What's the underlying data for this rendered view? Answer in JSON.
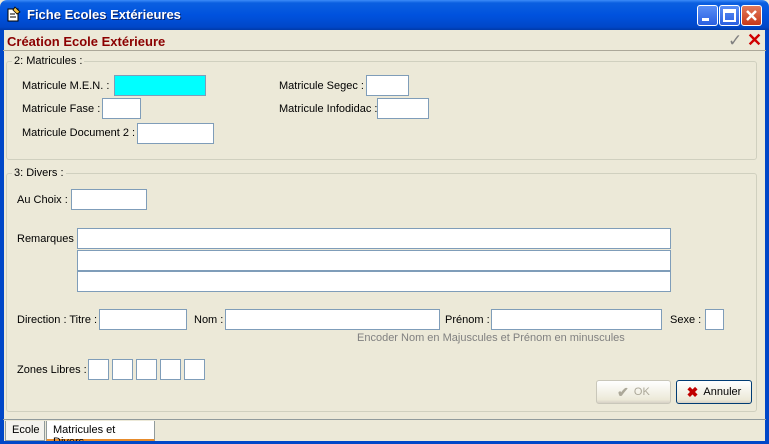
{
  "window": {
    "title": "Fiche Ecoles Extérieures",
    "header_title": "Création Ecole Extérieure"
  },
  "matricules": {
    "group_label": "2: Matricules :",
    "men_label": "Matricule M.E.N. :",
    "fase_label": "Matricule Fase :",
    "doc2_label": "Matricule Document 2 :",
    "segec_label": "Matricule Segec :",
    "infodidac_label": "Matricule Infodidac :"
  },
  "divers": {
    "group_label": "3: Divers :",
    "au_choix_label": "Au Choix :",
    "remarques_label": "Remarques",
    "direction_titre_label": "Direction : Titre :",
    "nom_label": "Nom :",
    "prenom_label": "Prénom :",
    "sexe_label": "Sexe :",
    "hint": "Encoder Nom en Majuscules et Prénom en minuscules",
    "zones_libres_label": "Zones Libres :"
  },
  "buttons": {
    "ok_label": "OK",
    "annuler_label": "Annuler"
  },
  "tabs": [
    {
      "label": "Ecole",
      "active": false
    },
    {
      "label": "Matricules et Divers",
      "active": true
    }
  ],
  "colors": {
    "titlebar": "#0052de",
    "header_title": "#8b0000",
    "highlighted_field": "#00ffff"
  },
  "icons": {
    "app": "notepad-icon",
    "check": "checkmark-icon",
    "close": "close-icon"
  }
}
